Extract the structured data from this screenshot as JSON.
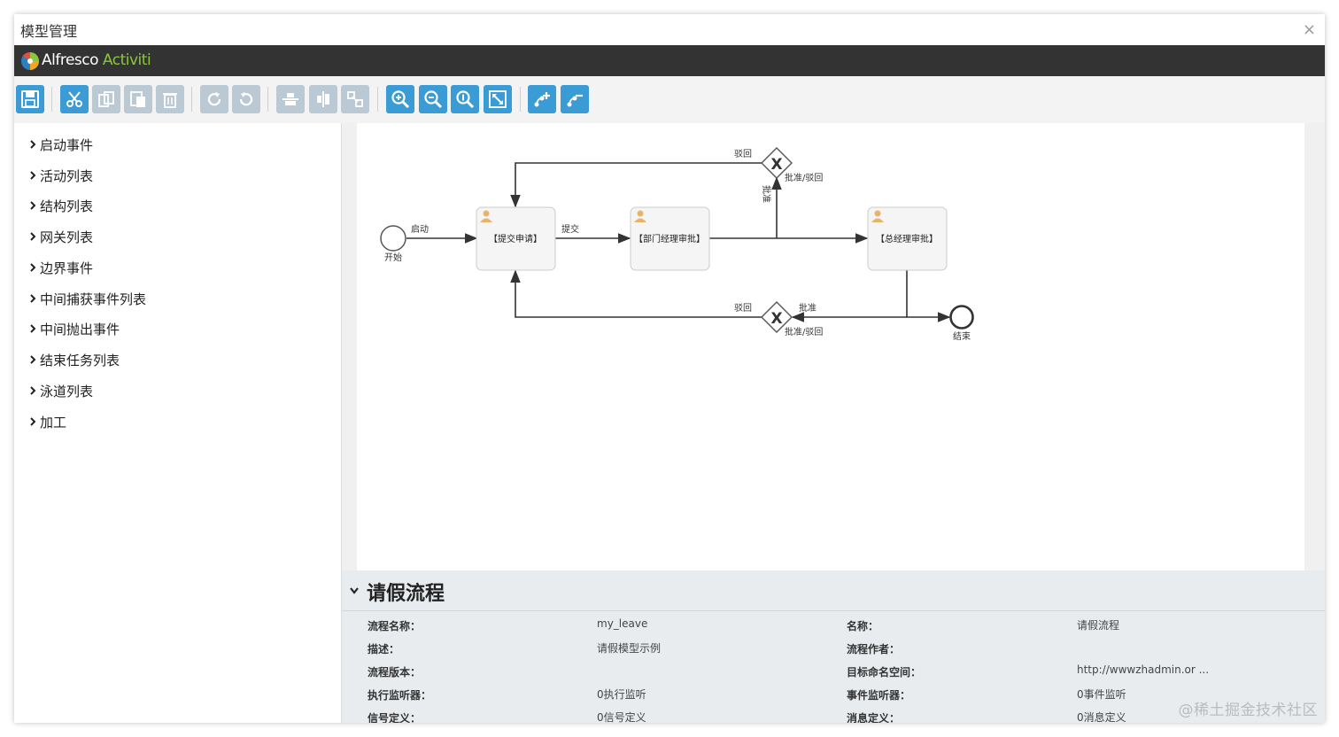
{
  "window": {
    "title": "模型管理",
    "close_glyph": "×"
  },
  "brand": {
    "name_part1": "Alfresco",
    "name_part2": " Activiti"
  },
  "toolbar": {
    "buttons": [
      {
        "icon": "save-icon",
        "enabled": true
      },
      {
        "icon": "cut-icon",
        "enabled": true
      },
      {
        "icon": "copy-icon",
        "enabled": false
      },
      {
        "icon": "paste-icon",
        "enabled": false
      },
      {
        "icon": "delete-icon",
        "enabled": false
      },
      {
        "icon": "redo-icon",
        "enabled": false
      },
      {
        "icon": "undo-icon",
        "enabled": false
      },
      {
        "icon": "align-horizontal-icon",
        "enabled": false
      },
      {
        "icon": "align-vertical-icon",
        "enabled": false
      },
      {
        "icon": "same-size-icon",
        "enabled": false
      },
      {
        "icon": "zoom-in-icon",
        "enabled": true
      },
      {
        "icon": "zoom-out-icon",
        "enabled": true
      },
      {
        "icon": "zoom-actual-icon",
        "enabled": true
      },
      {
        "icon": "zoom-fit-icon",
        "enabled": true
      },
      {
        "icon": "add-bendpoint-icon",
        "enabled": true
      },
      {
        "icon": "remove-bendpoint-icon",
        "enabled": true
      }
    ],
    "colors": {
      "enabled": "#3a9bd5",
      "disabled": "#bac9d3"
    }
  },
  "sidebar": {
    "items": [
      {
        "label": "启动事件"
      },
      {
        "label": "活动列表"
      },
      {
        "label": "结构列表"
      },
      {
        "label": "网关列表"
      },
      {
        "label": "边界事件"
      },
      {
        "label": "中间捕获事件列表"
      },
      {
        "label": "中间抛出事件"
      },
      {
        "label": "结束任务列表"
      },
      {
        "label": "泳道列表"
      },
      {
        "label": "加工"
      }
    ]
  },
  "diagram": {
    "start_label": "开始",
    "end_label": "结束",
    "tasks": [
      "【提交申请】",
      "【部门经理审批】",
      "【总经理审批】"
    ],
    "flows": {
      "start": "启动",
      "submit": "提交",
      "reject_top": "驳回",
      "approve_vertical": "批准",
      "gateway1_label": "批准/驳回",
      "reject_bottom": "驳回",
      "approve_bottom": "批准",
      "gateway2_label": "批准/驳回"
    },
    "gateway_symbol": "X"
  },
  "properties": {
    "title": "请假流程",
    "rows": [
      {
        "left_label": "流程名称：",
        "left_value": "my_leave",
        "right_label": "名称：",
        "right_value": "请假流程"
      },
      {
        "left_label": "描述：",
        "left_value": "请假模型示例",
        "right_label": "流程作者：",
        "right_value": ""
      },
      {
        "left_label": "流程版本：",
        "left_value": "",
        "right_label": "目标命名空间：",
        "right_value": "http://wwwzhadmin.or ..."
      },
      {
        "left_label": "执行监听器：",
        "left_value": "0执行监听",
        "right_label": "事件监听器：",
        "right_value": "0事件监听"
      },
      {
        "left_label": "信号定义：",
        "left_value": "0信号定义",
        "right_label": "消息定义：",
        "right_value": "0消息定义"
      }
    ]
  },
  "watermark": "@稀土掘金技术社区"
}
